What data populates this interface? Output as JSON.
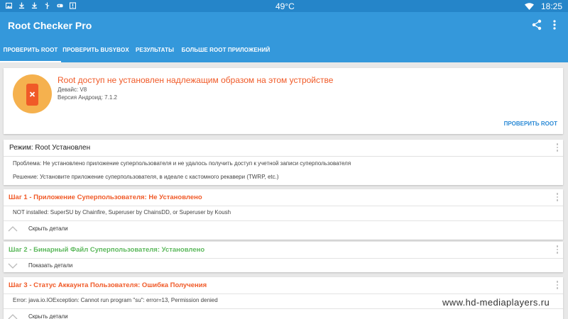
{
  "statusbar": {
    "temperature": "49°C",
    "time": "18:25",
    "left_icons": [
      "image-icon",
      "download-icon",
      "download-icon",
      "usb-icon",
      "gamepad-icon",
      "warning-icon"
    ]
  },
  "appbar": {
    "title": "Root Checker Pro"
  },
  "tabs": [
    {
      "label": "ПРОВЕРИТЬ ROOT",
      "active": true
    },
    {
      "label": "ПРОВЕРИТЬ BUSYBOX",
      "active": false
    },
    {
      "label": "РЕЗУЛЬТАТЫ",
      "active": false
    },
    {
      "label": "БОЛЬШЕ ROOT ПРИЛОЖЕНИЙ",
      "active": false
    }
  ],
  "status": {
    "title": "Root доступ не установлен надлежащим образом на этом устройстве",
    "device": "Девайс: V8",
    "android": "Версия Андроид: 7.1.2",
    "check_button": "ПРОВЕРИТЬ ROOT"
  },
  "mode": {
    "title": "Режим: Root Установлен",
    "problem": "Проблема: Не установлено приложение суперпользователя и не удалось получить доступ к учетной записи суперпользователя",
    "solution": "Решение: Установите приложение суперпользователя, в идеале с кастомного рекавери (TWRP, etc.)"
  },
  "steps": [
    {
      "title": "Шаг 1 - Приложение Суперпользователя: Не Установлено",
      "body": "NOT installed: SuperSU by Chainfire, Superuser by ChainsDD, or Superuser by Koush",
      "toggle": "Скрыть детали"
    },
    {
      "title": "Шаг 2 - Бинарный Файл Суперпользователя: Установлено",
      "toggle": "Показать детали"
    },
    {
      "title": "Шаг 3 - Статус Аккаунта Пользователя: Ошибка Получения",
      "body": "Error: java.io.IOException: Cannot run program \"su\": error=13, Permission denied",
      "toggle": "Скрыть детали"
    }
  ],
  "watermark": "www.hd-mediaplayers.ru",
  "colors": {
    "statusbar": "#2585c9",
    "appbar": "#3498db",
    "error": "#f05a28",
    "success": "#5cb85c",
    "badge": "#f5b14e",
    "link": "#2b8ad6"
  }
}
